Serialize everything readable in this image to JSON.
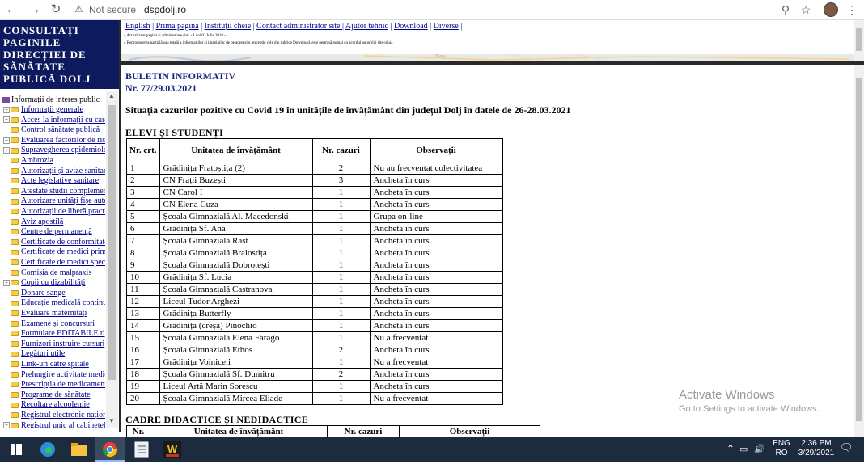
{
  "browser": {
    "security_label": "Not secure",
    "url": "dspdolj.ro"
  },
  "left_title": [
    "CONSULTAȚI",
    "PAGINILE",
    "DIRECȚIEI DE",
    "SĂNĂTATE",
    "PUBLICĂ DOLJ"
  ],
  "nav": {
    "root": "Informații de interes public",
    "items": [
      {
        "label": "Informații generale",
        "expand": true
      },
      {
        "label": "Acces la informații cu caracter public",
        "expand": true
      },
      {
        "label": "Control sănătate publică",
        "expand": false
      },
      {
        "label": "Evaluarea factorilor de risc",
        "expand": true
      },
      {
        "label": "Supravegherea epidemiologică",
        "expand": true
      },
      {
        "label": "Ambrozia",
        "expand": false
      },
      {
        "label": "Autorizații și avize sanitare",
        "expand": false
      },
      {
        "label": "Acte legislative sanitare",
        "expand": false
      },
      {
        "label": "Atestate studii complementare",
        "expand": false
      },
      {
        "label": "Autorizare unități fișe auto",
        "expand": false
      },
      {
        "label": "Autorizații de liberă practică",
        "expand": false
      },
      {
        "label": "Aviz apostilă",
        "expand": false
      },
      {
        "label": "Centre de permanență",
        "expand": false
      },
      {
        "label": "Certificate de conformitate",
        "expand": false
      },
      {
        "label": "Certificate de medici primari",
        "expand": false
      },
      {
        "label": "Certificate de medici specialiști",
        "expand": false
      },
      {
        "label": "Comisia de malpraxis",
        "expand": false
      },
      {
        "label": "Copii cu dizabilități",
        "expand": true
      },
      {
        "label": "Donare sange",
        "expand": false
      },
      {
        "label": "Educație medicală continuă",
        "expand": false
      },
      {
        "label": "Evaluare maternități",
        "expand": false
      },
      {
        "label": "Examene și concursuri",
        "expand": false
      },
      {
        "label": "Formulare EDITABILE tip",
        "expand": false
      },
      {
        "label": "Furnizori instruire cursuri",
        "expand": false
      },
      {
        "label": "Legături utile",
        "expand": false
      },
      {
        "label": "Link-uri către spitale",
        "expand": false
      },
      {
        "label": "Prelungire activitate medici",
        "expand": false
      },
      {
        "label": "Prescripția de medicamente",
        "expand": false
      },
      {
        "label": "Programe de sănătate",
        "expand": false
      },
      {
        "label": "Recoltare alcoolemie",
        "expand": false
      },
      {
        "label": "Registrul electronic național",
        "expand": false
      },
      {
        "label": "Registrul unic al cabinetelor",
        "expand": true
      }
    ]
  },
  "top": {
    "links": [
      "English",
      "Prima pagina",
      "Instituții cheie",
      " Contact administrator site ",
      "Ajutor tehnic",
      "Download",
      "Diverse"
    ],
    "small1": "« Actualizare pagina si administrare site: - Luni 02 Iulie 2018 »",
    "small2": "« Reproducerea parțială sau totală a informațiilor și imaginilor de pe acest site, excepție cele din rubrica Download, este permisă numai cu acordul autorului site-ului»",
    "map_label": "Turnu"
  },
  "main": {
    "bulletin_title": "BULETIN INFORMATIV",
    "bulletin_number": "Nr. 77/29.03.2021",
    "headline": "Situația cazurilor pozitive cu Covid 19 în unitățile de învățământ din județul Dolj în datele de 26-28.03.2021",
    "section1": "ELEVI ȘI STUDENȚI",
    "section2": "CADRE DIDACTICE ȘI NEDIDACTICE",
    "headers": {
      "nr": "Nr. crt.",
      "unit": "Unitatea de învățământ",
      "cases": "Nr. cazuri",
      "obs": "Observații"
    },
    "headers2": {
      "nr": "Nr.",
      "unit": "Unitatea de învățământ",
      "cases": "Nr. cazuri",
      "obs": "Observații"
    },
    "rows": [
      {
        "nr": "1",
        "unit": "Grădinița Fratoștița (2)",
        "cases": "2",
        "obs": "Nu au frecventat colectivitatea"
      },
      {
        "nr": "2",
        "unit": "CN Frații Buzești",
        "cases": "3",
        "obs": "Ancheta în curs"
      },
      {
        "nr": "3",
        "unit": "CN Carol I",
        "cases": "1",
        "obs": "Ancheta în curs"
      },
      {
        "nr": "4",
        "unit": "CN Elena Cuza",
        "cases": "1",
        "obs": "Ancheta în curs"
      },
      {
        "nr": "5",
        "unit": "Școala Gimnazială Al. Macedonski",
        "cases": "1",
        "obs": "Grupa on-line"
      },
      {
        "nr": "6",
        "unit": "Grădinița Sf. Ana",
        "cases": "1",
        "obs": "Ancheta în curs"
      },
      {
        "nr": "7",
        "unit": "Școala Gimnazială Rast",
        "cases": "1",
        "obs": "Ancheta în curs"
      },
      {
        "nr": "8",
        "unit": "Școala Gimnazială Bralostița",
        "cases": "1",
        "obs": "Ancheta în curs"
      },
      {
        "nr": "9",
        "unit": "Școala Gimnazială Dobrotești",
        "cases": "1",
        "obs": "Ancheta în curs"
      },
      {
        "nr": "10",
        "unit": "Grădinița Sf. Lucia",
        "cases": "1",
        "obs": "Ancheta în curs"
      },
      {
        "nr": "11",
        "unit": "Școala Gimnazială Castranova",
        "cases": "1",
        "obs": "Ancheta în curs"
      },
      {
        "nr": "12",
        "unit": "Liceul Tudor Arghezi",
        "cases": "1",
        "obs": "Ancheta în curs"
      },
      {
        "nr": "13",
        "unit": "Grădinița Butterfly",
        "cases": "1",
        "obs": "Ancheta în curs"
      },
      {
        "nr": "14",
        "unit": "Grădinița (creșa) Pinochio",
        "cases": "1",
        "obs": "Ancheta în curs"
      },
      {
        "nr": "15",
        "unit": "Școala Gimnazială Elena Farago",
        "cases": "1",
        "obs": "Nu a frecventat"
      },
      {
        "nr": "16",
        "unit": "Școala Gimnazială Ethos",
        "cases": "2",
        "obs": "Ancheta în curs"
      },
      {
        "nr": "17",
        "unit": "Grădinița Voiniceii",
        "cases": "1",
        "obs": "Nu a frecventat"
      },
      {
        "nr": "18",
        "unit": "Școala Gimnazială Sf. Dumitru",
        "cases": "2",
        "obs": "Ancheta în curs"
      },
      {
        "nr": "19",
        "unit": "Liceul Artă Marin Sorescu",
        "cases": "1",
        "obs": "Ancheta în curs"
      },
      {
        "nr": "20",
        "unit": "Școala Gimnazială Mircea Eliade",
        "cases": "1",
        "obs": "Nu a frecventat"
      }
    ]
  },
  "watermark": {
    "line1": "Activate Windows",
    "line2": "Go to Settings to activate Windows."
  },
  "taskbar": {
    "lang1": "ENG",
    "lang2": "RO",
    "time": "2:36 PM",
    "date": "3/29/2021"
  }
}
